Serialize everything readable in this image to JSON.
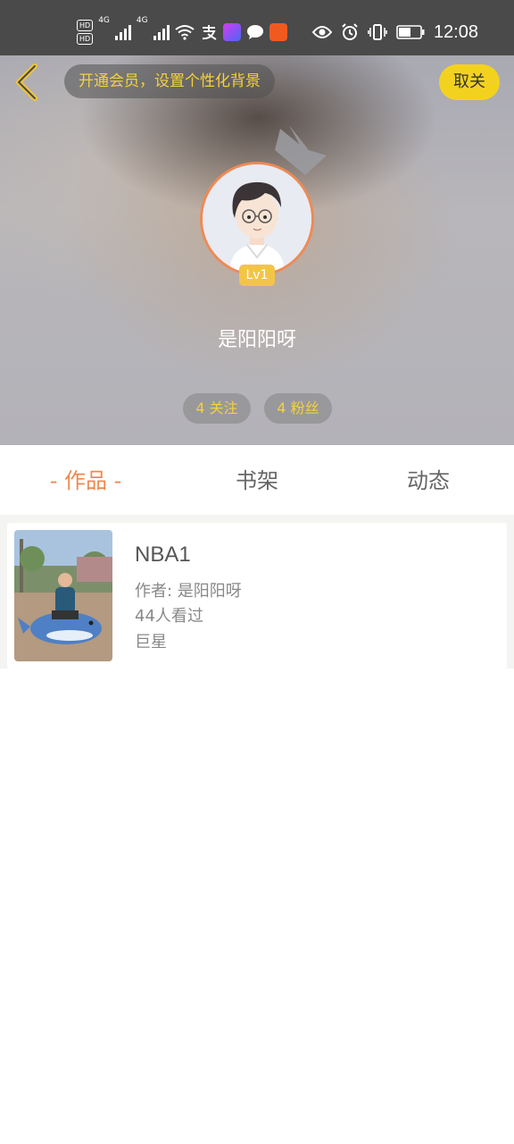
{
  "status_bar": {
    "hd1": "HD",
    "hd2": "HD",
    "net1": "4G",
    "net2": "4G",
    "time": "12:08"
  },
  "header": {
    "promo_text": "开通会员，设置个性化背景",
    "follow_button": "取关",
    "level": "Lv1",
    "nickname": "是阳阳呀",
    "following": "4 关注",
    "followers": "4 粉丝"
  },
  "tabs": [
    {
      "label": "- 作品 -",
      "active": true
    },
    {
      "label": "书架",
      "active": false
    },
    {
      "label": "动态",
      "active": false
    }
  ],
  "works": [
    {
      "title": "NBA1",
      "author": "作者: 是阳阳呀",
      "views": "44人看过",
      "tag": "巨星"
    }
  ],
  "colors": {
    "accent": "#f0884f",
    "yellow": "#f3d21f",
    "statusbar": "#4a4a4a"
  }
}
